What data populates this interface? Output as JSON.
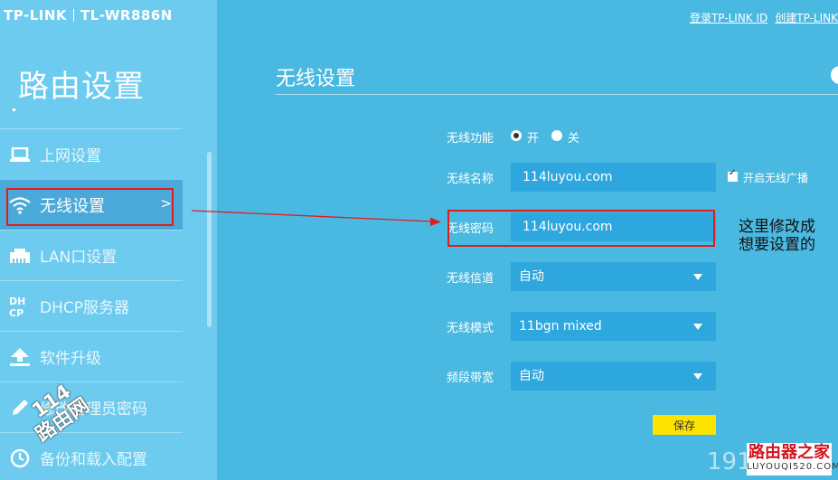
{
  "header": {
    "brand": "TP-LINK",
    "model": "TL-WR886N",
    "login_link": "登录TP-LINK ID",
    "create_link": "创建TP-LINK"
  },
  "sidebar": {
    "title": "路由设置",
    "items": [
      {
        "label": "上网设置",
        "icon": "monitor-icon"
      },
      {
        "label": "无线设置",
        "icon": "wifi-icon",
        "active": true,
        "chevron": ">"
      },
      {
        "label": "LAN口设置",
        "icon": "lan-icon"
      },
      {
        "label": "DHCP服务器",
        "icon": "dhcp-icon",
        "icon_text": "DHCP"
      },
      {
        "label": "软件升级",
        "icon": "upload-icon"
      },
      {
        "label": "修改管理员密码",
        "icon": "pencil-icon"
      },
      {
        "label": "备份和载入配置",
        "icon": "clock-icon"
      }
    ]
  },
  "main": {
    "title": "无线设置",
    "wireless_function": {
      "label": "无线功能",
      "on_label": "开",
      "off_label": "关",
      "value": "on"
    },
    "ssid": {
      "label": "无线名称",
      "value": "114luyou.com",
      "broadcast_label": "开启无线广播",
      "broadcast": true
    },
    "password": {
      "label": "无线密码",
      "value": "114luyou.com"
    },
    "channel": {
      "label": "无线信道",
      "value": "自动"
    },
    "mode": {
      "label": "无线模式",
      "value": "11bgn mixed"
    },
    "bandwidth": {
      "label": "频段带宽",
      "value": "自动"
    },
    "save_label": "保存"
  },
  "annotation": {
    "line1": "这里修改成",
    "line2": "想要设置的"
  },
  "watermarks": {
    "left_num": "114",
    "left_text": "路由网",
    "right_num": "191",
    "right_logo_zh": "路由器之家",
    "right_logo_en": "LUYOUQI520.COM"
  },
  "colors": {
    "background": "#4ab9e1",
    "sidebar": "#6ccbef",
    "field": "#2ea7de",
    "save_button": "#fde300",
    "highlight": "#e21b1b"
  }
}
